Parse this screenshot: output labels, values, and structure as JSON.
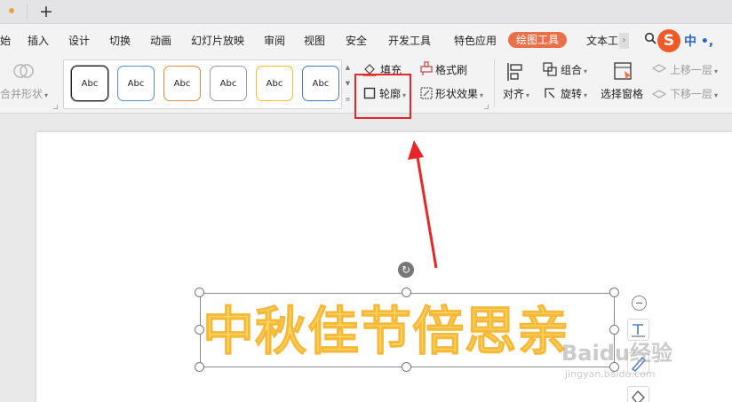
{
  "tabstrip": {
    "new_tab": "+"
  },
  "menu": {
    "items": [
      "始",
      "插入",
      "设计",
      "切换",
      "动画",
      "幻灯片放映",
      "审阅",
      "视图",
      "安全",
      "开发工具",
      "特色应用",
      "绘图工具",
      "文本工"
    ],
    "active_item": "绘图工具",
    "more_chevron": "›"
  },
  "ime": {
    "label": "中 •,",
    "logo": "S"
  },
  "ribbon": {
    "merge_shapes": "合并形状",
    "style_swatches": [
      {
        "label": "Abc",
        "border": "#222222"
      },
      {
        "label": "Abc",
        "border": "#5a8fd0"
      },
      {
        "label": "Abc",
        "border": "#e68a3c"
      },
      {
        "label": "Abc",
        "border": "#9a9a9a"
      },
      {
        "label": "Abc",
        "border": "#f0c420"
      },
      {
        "label": "Abc",
        "border": "#4a78c0"
      }
    ],
    "fill": "填充",
    "outline": "轮廓",
    "format_painter": "格式刷",
    "shape_effects": "形状效果",
    "align": "对齐",
    "group": "组合",
    "rotate": "旋转",
    "selection_pane": "选择窗格",
    "bring_forward": "上移一层",
    "send_backward": "下移一层"
  },
  "slide": {
    "wordart_text": "中秋佳节倍思亲"
  },
  "watermark": {
    "main": "Baidu经验",
    "url": "jingyan.baidu.com"
  },
  "colors": {
    "accent_tab": "#e8704a",
    "highlight": "#e8262a",
    "arrow": "#e8262a",
    "wordart_fill": "#ffd860"
  }
}
